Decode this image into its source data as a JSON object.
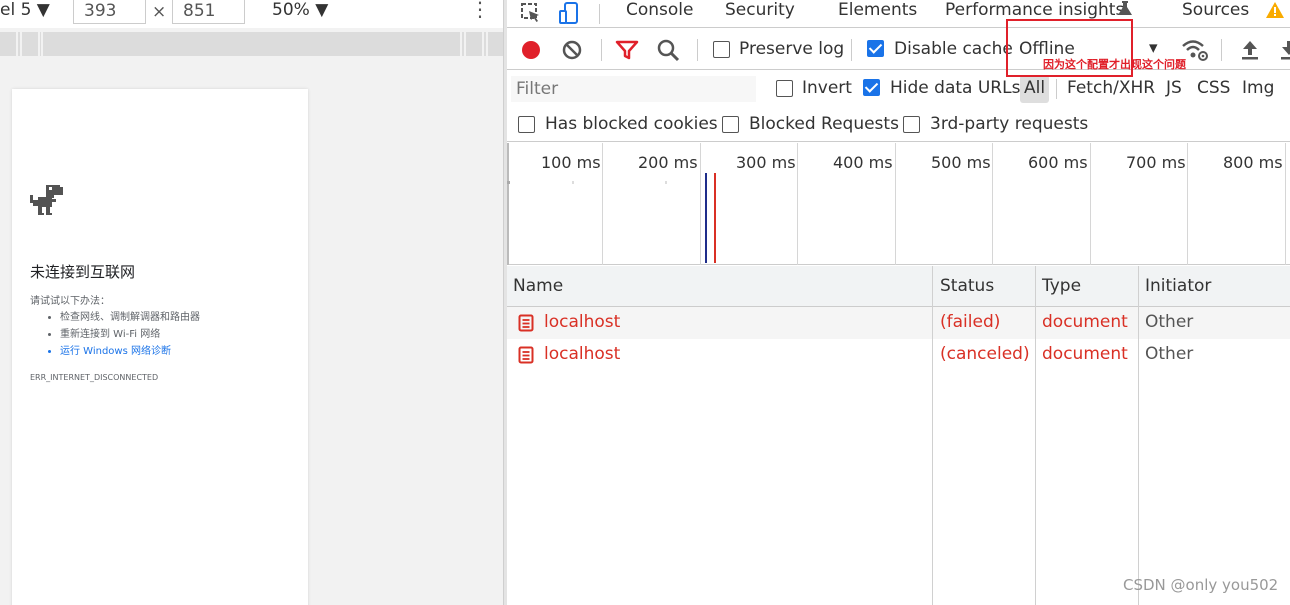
{
  "device_toolbar": {
    "device_name": "el 5 ▼",
    "width": "393",
    "times": "×",
    "height": "851",
    "zoom": "50% ▼",
    "menu_glyph": "⋮"
  },
  "error_page": {
    "title": "未连接到互联网",
    "try_label": "请试试以下办法：",
    "suggestions": [
      "检查网线、调制解调器和路由器",
      "重新连接到 Wi-Fi 网络",
      "运行 Windows 网络诊断"
    ],
    "error_code": "ERR_INTERNET_DISCONNECTED",
    "icon": "dino-icon"
  },
  "devtools": {
    "tabs": [
      "Console",
      "Security",
      "Elements",
      "Performance insights",
      "Sources"
    ],
    "warning_icon": "warning-icon",
    "toolbar": {
      "preserve_log": "Preserve log",
      "preserve_log_checked": false,
      "disable_cache": "Disable cache",
      "disable_cache_checked": true,
      "throttling": "Offline",
      "dropdown_glyph": "▾"
    },
    "filter": {
      "placeholder": "Filter",
      "invert": "Invert",
      "invert_checked": false,
      "hide_data_urls": "Hide data URLs",
      "hide_data_urls_checked": true,
      "types": [
        "All",
        "Fetch/XHR",
        "JS",
        "CSS",
        "Img"
      ]
    },
    "blocked": {
      "has_blocked_cookies": "Has blocked cookies",
      "blocked_requests": "Blocked Requests",
      "third_party": "3rd-party requests"
    },
    "overview_ticks": [
      "100 ms",
      "200 ms",
      "300 ms",
      "400 ms",
      "500 ms",
      "600 ms",
      "700 ms",
      "800 ms"
    ],
    "columns": [
      "Name",
      "Status",
      "Type",
      "Initiator"
    ],
    "requests": [
      {
        "name": "localhost",
        "status": "(failed)",
        "type": "document",
        "initiator": "Other"
      },
      {
        "name": "localhost",
        "status": "(canceled)",
        "type": "document",
        "initiator": "Other"
      }
    ],
    "colors": {
      "error": "#d93025",
      "accent": "#1a73e8",
      "record": "#e0202a",
      "annotation": "#e0202a"
    }
  },
  "annotation": {
    "text": "因为这个配置才出现这个问题"
  },
  "watermark": "CSDN @only you502"
}
